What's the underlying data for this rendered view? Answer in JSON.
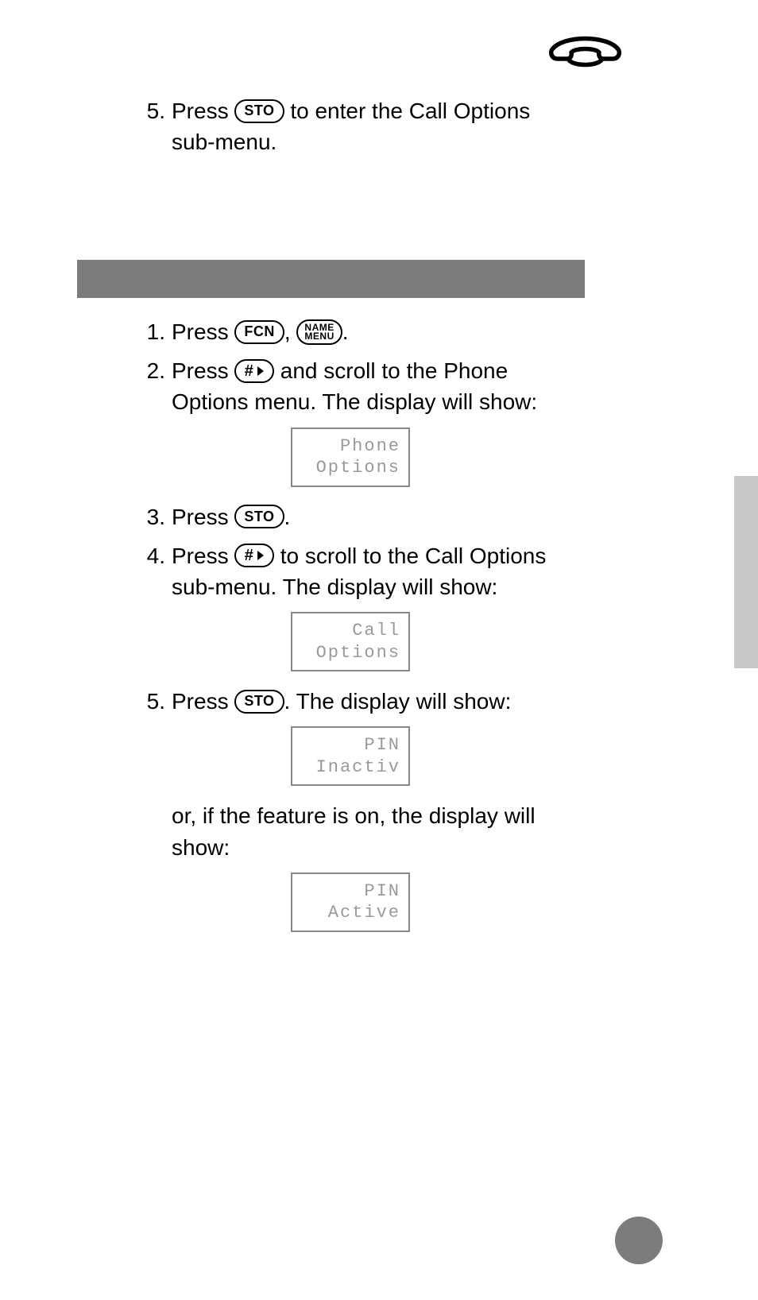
{
  "topStep": {
    "num": "5.",
    "before": "Press ",
    "key": "STO",
    "after": " to enter the Call Options sub-menu."
  },
  "steps": [
    {
      "num": "1.",
      "before": "Press ",
      "key1": "FCN",
      "mid": ", ",
      "key2_top": "NAME",
      "key2_bot": "MENU",
      "after": "."
    },
    {
      "num": "2.",
      "before": "Press ",
      "hashKey": "#",
      "after": " and scroll to the Phone Options menu. The display will show:",
      "display": "Phone\nOptions"
    },
    {
      "num": "3.",
      "before": "Press ",
      "key": "STO",
      "after": "."
    },
    {
      "num": "4.",
      "before": "Press ",
      "hashKey": "#",
      "after": " to scroll to the Call Options sub-menu. The display will show:",
      "display": "Call\nOptions"
    },
    {
      "num": "5.",
      "before": "Press ",
      "key": "STO",
      "after": ". The display will show:",
      "display": "PIN\nInactiv",
      "altText": "or, if the feature is on, the display will show:",
      "altDisplay": "PIN\nActive"
    }
  ]
}
